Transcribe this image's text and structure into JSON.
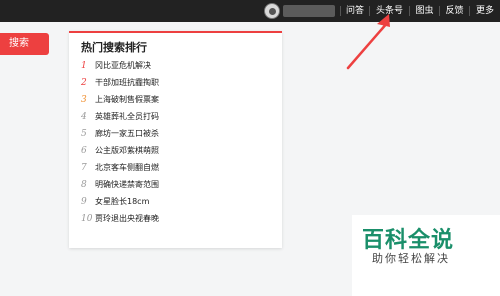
{
  "topbar": {
    "nav": [
      "问答",
      "头条号",
      "图虫",
      "反馈",
      "更多"
    ]
  },
  "sidebar": {
    "search_label": "搜索"
  },
  "hot": {
    "title": "热门搜索排行",
    "items": [
      {
        "rank": "1",
        "text": "冈比亚危机解决"
      },
      {
        "rank": "2",
        "text": "干部加班抗霾掏职"
      },
      {
        "rank": "3",
        "text": "上海破制售假票案"
      },
      {
        "rank": "4",
        "text": "英雄葬礼全员打码"
      },
      {
        "rank": "5",
        "text": "廊坊一家五口被杀"
      },
      {
        "rank": "6",
        "text": "公主版邓紫棋萌照"
      },
      {
        "rank": "7",
        "text": "北京客车侧翻自燃"
      },
      {
        "rank": "8",
        "text": "明确快递禁寄范围"
      },
      {
        "rank": "9",
        "text": "女星脸长18cm"
      },
      {
        "rank": "10",
        "text": "贾玲退出央视春晚"
      }
    ]
  },
  "watermark": {
    "main": "百科全说",
    "sub": "助你轻松解决"
  },
  "colors": {
    "accent": "#ed4040",
    "rank_top": "#f08c2a",
    "watermark": "#1a8f6a"
  }
}
